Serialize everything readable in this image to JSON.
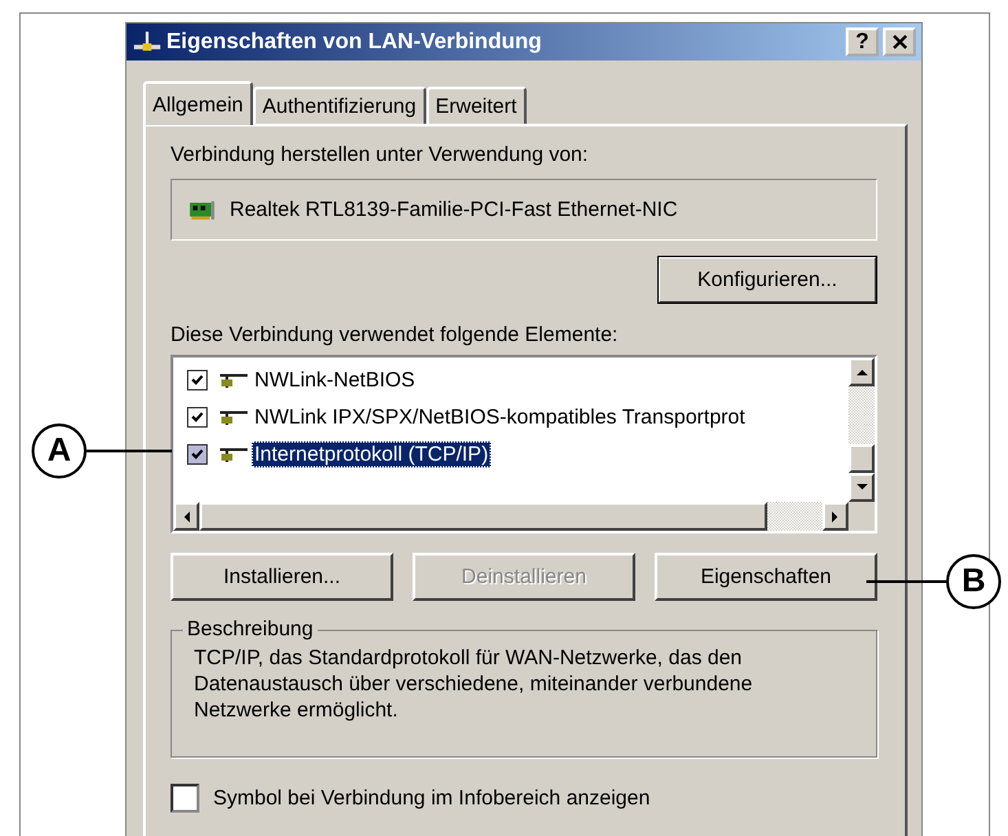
{
  "window": {
    "title": "Eigenschaften von LAN-Verbindung",
    "help_button": "?"
  },
  "tabs": [
    {
      "label": "Allgemein",
      "selected": true
    },
    {
      "label": "Authentifizierung",
      "selected": false
    },
    {
      "label": "Erweitert",
      "selected": false
    }
  ],
  "connect_using": {
    "label": "Verbindung herstellen unter Verwendung von:",
    "adapter": "Realtek RTL8139-Familie-PCI-Fast Ethernet-NIC"
  },
  "configure_button": {
    "label": "Konfigurieren..."
  },
  "components": {
    "label": "Diese Verbindung verwendet folgende Elemente:",
    "items": [
      {
        "label": "NWLink-NetBIOS",
        "checked": true,
        "selected": false
      },
      {
        "label": "NWLink IPX/SPX/NetBIOS-kompatibles Transportprot",
        "checked": true,
        "selected": false
      },
      {
        "label": "Internetprotokoll (TCP/IP)",
        "checked": true,
        "selected": true
      }
    ]
  },
  "buttons": [
    {
      "label": "Installieren...",
      "disabled": false
    },
    {
      "label": "Deinstallieren",
      "disabled": true
    },
    {
      "label": "Eigenschaften",
      "disabled": false
    }
  ],
  "description": {
    "title": "Beschreibung",
    "text": "TCP/IP, das Standardprotokoll für WAN-Netzwerke, das den Datenaustausch über verschiedene, miteinander verbundene Netzwerke ermöglicht."
  },
  "tray_checkbox": {
    "label": "Symbol bei Verbindung im Infobereich anzeigen",
    "checked": false
  },
  "callouts": [
    {
      "letter": "A"
    },
    {
      "letter": "B"
    }
  ]
}
